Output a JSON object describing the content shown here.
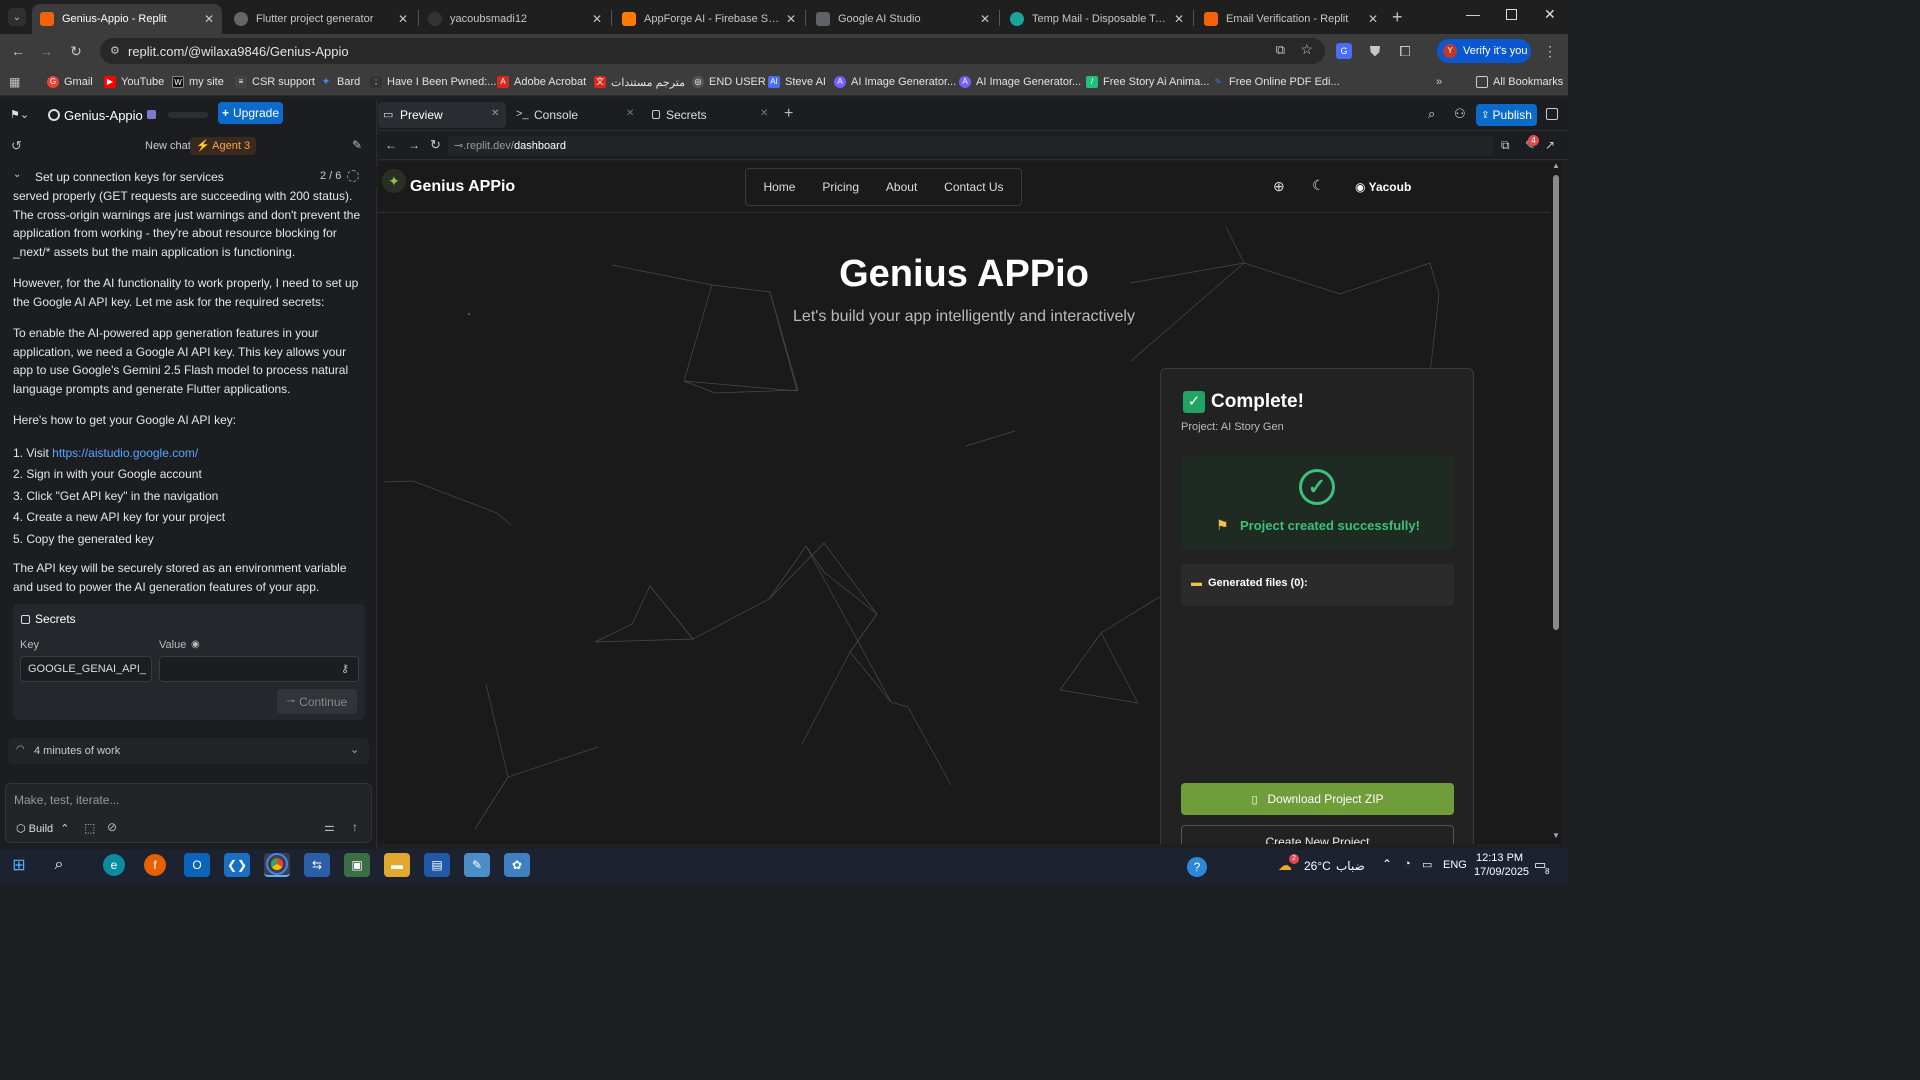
{
  "browser": {
    "tabs": [
      {
        "title": "Genius-Appio - Replit",
        "color": "#f26207",
        "active": true
      },
      {
        "title": "Flutter project generator",
        "color": "#888888",
        "active": false
      },
      {
        "title": "yacoubsmadi12",
        "color": "#444444",
        "active": false
      },
      {
        "title": "AppForge AI - Firebase Studio",
        "color": "#ff7a00",
        "active": false
      },
      {
        "title": "Google AI Studio",
        "color": "#5f6368",
        "active": false
      },
      {
        "title": "Temp Mail - Disposable Tempo",
        "color": "#1aa59a",
        "active": false
      },
      {
        "title": "Email Verification - Replit",
        "color": "#f26207",
        "active": false
      }
    ],
    "url": "replit.com/@wilaxa9846/Genius-Appio",
    "profile_label": "Verify it's you",
    "bookmarks": [
      {
        "label": "Gmail",
        "color": "#ea4335"
      },
      {
        "label": "YouTube",
        "color": "#ff0000"
      },
      {
        "label": "my site",
        "color": "#2b2b2b"
      },
      {
        "label": "CSR support",
        "color": "#444444"
      },
      {
        "label": "Bard",
        "color": "#4285f4"
      },
      {
        "label": "Have I Been Pwned:...",
        "color": "#333333"
      },
      {
        "label": "Adobe Acrobat",
        "color": "#d7281e"
      },
      {
        "label": "مترجم مستندات",
        "color": "#d7281e"
      },
      {
        "label": "END USER",
        "color": "#555555"
      },
      {
        "label": "Steve AI",
        "color": "#4a6cf7"
      },
      {
        "label": "AI Image Generator...",
        "color": "#7a5cff"
      },
      {
        "label": "AI Image Generator...",
        "color": "#7a5cff"
      },
      {
        "label": "Free Story Ai Anima...",
        "color": "#21c17a"
      },
      {
        "label": "Free Online PDF Edi...",
        "color": "#3b82f6"
      }
    ],
    "all_bookmarks": "All Bookmarks"
  },
  "replit": {
    "project_name": "Genius-Appio",
    "upgrade_label": "Upgrade",
    "new_chat": "New chat",
    "agent_label": "Agent 3",
    "task_title": "Set up connection keys for services",
    "task_progress": "2 / 6",
    "chat": {
      "p1": "served properly (GET requests are succeeding with 200 status). The cross-origin warnings are just warnings and don't prevent the application from working - they're about resource blocking for _next/* assets but the main application is functioning.",
      "p2": "However, for the AI functionality to work properly, I need to set up the Google AI API key. Let me ask for the required secrets:",
      "p3": "To enable the AI-powered app generation features in your application, we need a Google AI API key. This key allows your app to use Google's Gemini 2.5 Flash model to process natural language prompts and generate Flutter applications.",
      "p4": "Here's how to get your Google AI API key:",
      "step1_prefix": "1. Visit ",
      "step1_link": "https://aistudio.google.com/",
      "step2": "2. Sign in with your Google account",
      "step3": "3. Click \"Get API key\" in the navigation",
      "step4": "4. Create a new API key for your project",
      "step5": "5. Copy the generated key",
      "p5": "The API key will be securely stored as an environment variable and used to power the AI generation features of your app."
    },
    "secrets": {
      "title": "Secrets",
      "key_label": "Key",
      "value_label": "Value",
      "key_value": "GOOGLE_GENAI_API_",
      "value_value": "",
      "continue_label": "Continue"
    },
    "work_summary": "4 minutes of work",
    "input_placeholder": "Make, test, iterate...",
    "build_label": "Build",
    "panel_tabs": [
      {
        "label": "Preview"
      },
      {
        "label": "Console"
      },
      {
        "label": "Secrets"
      }
    ],
    "publish_label": "Publish",
    "notif_count": "4",
    "preview_url_prefix": ".replit.dev/",
    "preview_url_path": "dashboard"
  },
  "site": {
    "logo_text": "Genius APPio",
    "nav": [
      "Home",
      "Pricing",
      "About",
      "Contact Us"
    ],
    "user_name": "Yacoub",
    "hero_title": "Genius APPio",
    "hero_subtitle": "Let's build your app intelligently and interactively",
    "card": {
      "title": "Complete!",
      "project": "Project: AI Story Gen",
      "success_text": "Project created successfully!",
      "files_label": "Generated files (0):",
      "download_label": "Download Project ZIP",
      "new_project_label": "Create New Project",
      "accent": "#6e9d3a"
    }
  },
  "taskbar": {
    "weather": "26°C",
    "weather_label": "ضباب",
    "lang": "ENG",
    "time": "12:13 PM",
    "date": "17/09/2025",
    "notif": "8",
    "weather_badge": "2"
  }
}
